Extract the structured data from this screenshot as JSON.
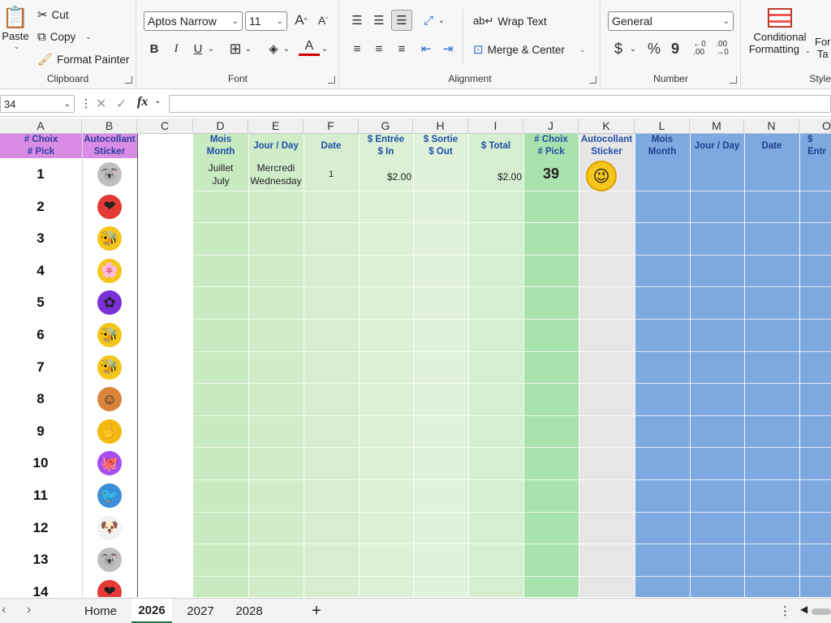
{
  "ribbon": {
    "clipboard": {
      "label": "Clipboard",
      "paste": "Paste",
      "cut": "Cut",
      "copy": "Copy",
      "format_painter": "Format Painter"
    },
    "font": {
      "label": "Font",
      "family": "Aptos Narrow",
      "size": "11",
      "bold": "B",
      "italic": "I",
      "underline": "U"
    },
    "alignment": {
      "label": "Alignment",
      "wrap_text": "Wrap Text",
      "merge_center": "Merge & Center"
    },
    "number": {
      "label": "Number",
      "format": "General",
      "currency": "$",
      "percent": "%",
      "comma": "9"
    },
    "styles": {
      "label": "Style",
      "conditional_line1": "Conditional",
      "conditional_line2": "Formatting",
      "format_table_line1": "For",
      "format_table_line2": "Ta"
    }
  },
  "formula_bar": {
    "name_box": "34",
    "fx": "fx"
  },
  "columns": [
    "A",
    "B",
    "C",
    "D",
    "E",
    "F",
    "G",
    "H",
    "I",
    "J",
    "K",
    "L",
    "M",
    "N",
    "O"
  ],
  "headers": {
    "a": [
      "# Choix",
      "# Pick"
    ],
    "b": [
      "Autocollant",
      "Sticker"
    ],
    "d": [
      "Mois",
      "Month"
    ],
    "e": [
      "Jour / Day"
    ],
    "f": [
      "Date"
    ],
    "g": [
      "$ Entrée",
      "$ In"
    ],
    "h": [
      "$ Sortie",
      "$ Out"
    ],
    "i": [
      "$ Total"
    ],
    "j": [
      "# Choix",
      "# Pick"
    ],
    "k": [
      "Autocollant",
      "Sticker"
    ],
    "l": [
      "Mois",
      "Month"
    ],
    "m": [
      "Jour / Day"
    ],
    "n": [
      "Date"
    ],
    "o": [
      "$ Entr"
    ]
  },
  "picks": [
    "1",
    "2",
    "3",
    "4",
    "5",
    "6",
    "7",
    "8",
    "9",
    "10",
    "11",
    "12",
    "13",
    "14"
  ],
  "stickers": [
    "koala-sticker",
    "heart-sticker",
    "bee-sticker",
    "bee-flower-sticker",
    "purple-flower-sticker",
    "bee-sticker",
    "bees-sticker",
    "boy-sticker",
    "glove-sticker",
    "octopus-sticker",
    "bird-sticker",
    "dog-sticker",
    "koala-sticker",
    "heart-sticker"
  ],
  "entry": {
    "month_fr": "Juillet",
    "month_en": "July",
    "day_fr": "Mercredi",
    "day_en": "Wednesday",
    "date": "1",
    "in": "$2.00",
    "total": "$2.00",
    "pick": "39",
    "sticker": "smiley-wave-sticker"
  },
  "sheets": {
    "home": "Home",
    "s2026": "2026",
    "s2027": "2027",
    "s2028": "2028",
    "add": "+"
  },
  "colors": {
    "pink": "#d98ce6",
    "green_light": "#d2eccb",
    "green_mid": "#c1e6b8",
    "green_pick": "#a8e0a8",
    "gray_k": "#e6e6e6",
    "blue": "#7aa7e0"
  }
}
